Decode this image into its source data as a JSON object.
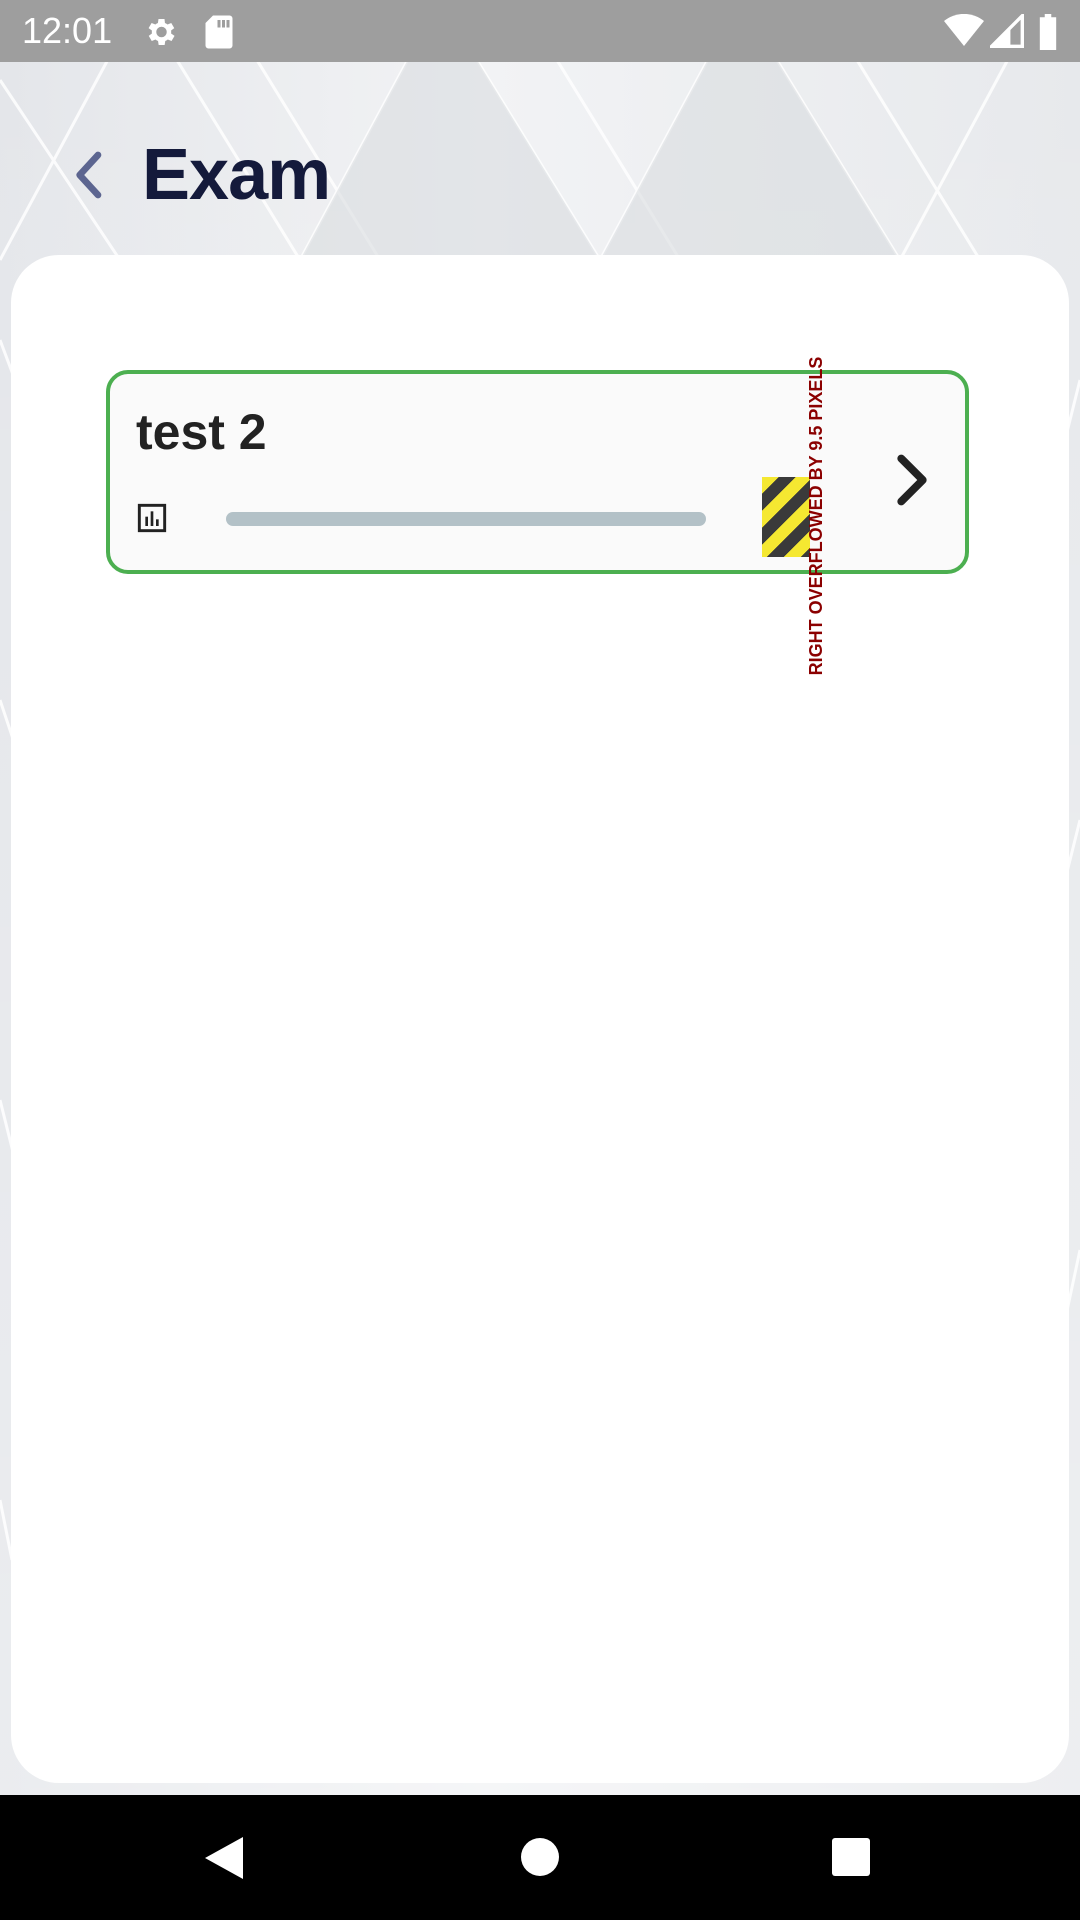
{
  "status_bar": {
    "time": "12:01",
    "icons": [
      "gear-icon",
      "sd-card-icon",
      "wifi-icon",
      "signal-icon",
      "battery-icon"
    ]
  },
  "header": {
    "title": "Exam",
    "back_icon": "chevron-left-icon"
  },
  "exam_list": [
    {
      "name": "test 2",
      "stats_icon": "bar-chart-icon",
      "overflow_warning": "RIGHT OVERFLOWED BY 9.5 PIXELS",
      "open_icon": "chevron-right-icon"
    }
  ],
  "nav_bar": {
    "buttons": [
      "back-triangle-icon",
      "home-circle-icon",
      "recents-square-icon"
    ]
  },
  "colors": {
    "title": "#141a3b",
    "item_border": "#4caf50",
    "progress_track": "#b3c1c7",
    "overflow_text": "#8b0000"
  }
}
